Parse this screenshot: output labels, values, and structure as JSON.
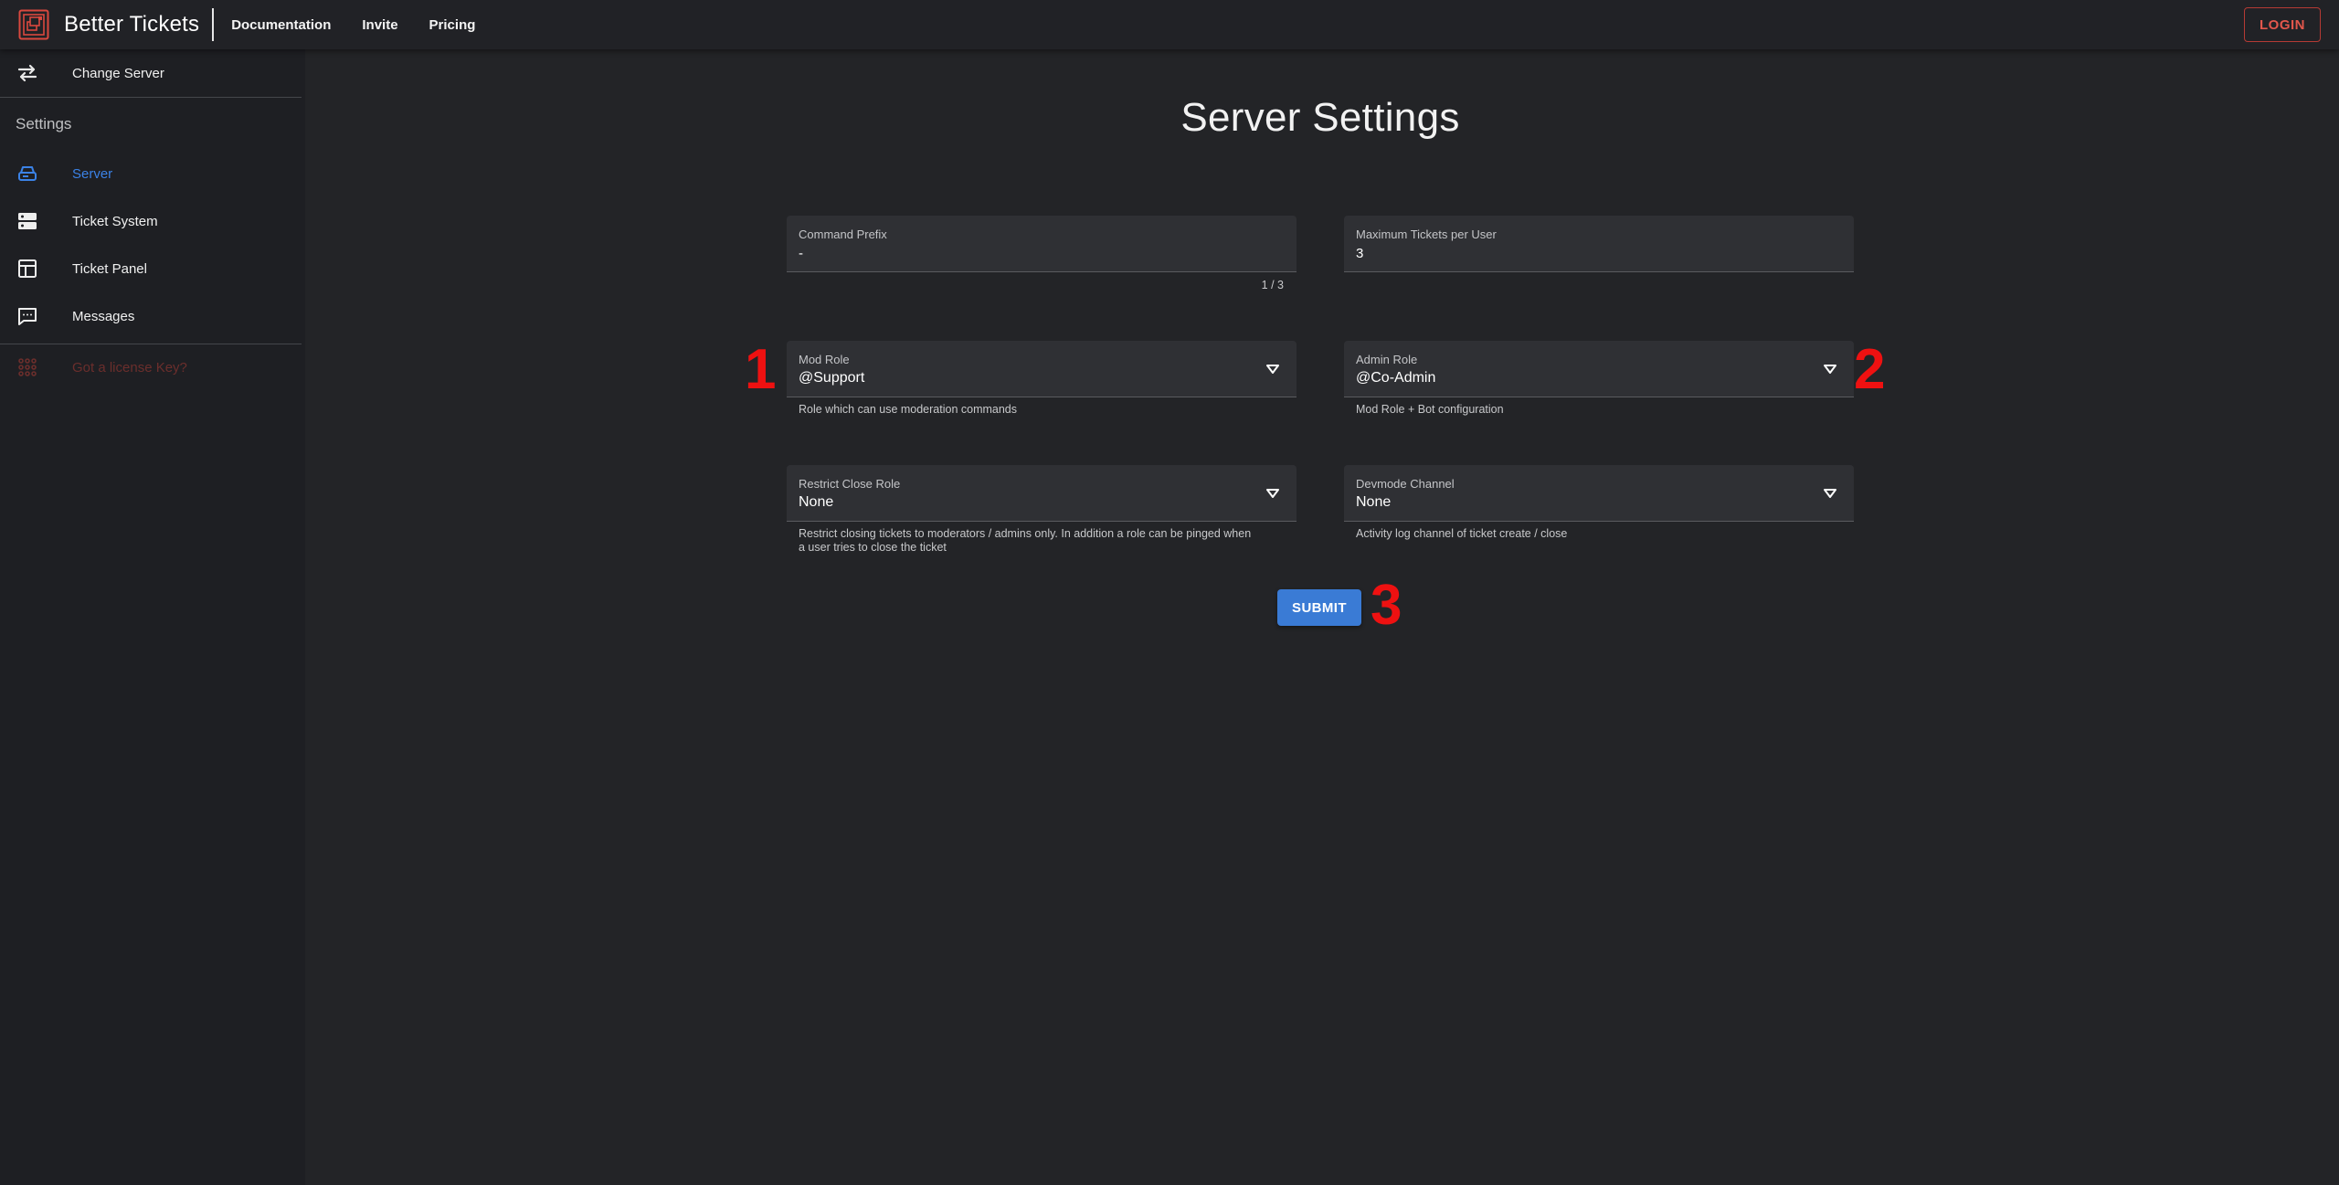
{
  "colors": {
    "background": "#232427",
    "sidebar": "#1e1f23",
    "accent": "#3a7bd5",
    "brand_red": "#e2574c",
    "marker_red": "#ee1111"
  },
  "header": {
    "brand": "Better Tickets",
    "nav": [
      "Documentation",
      "Invite",
      "Pricing"
    ],
    "login_label": "LOGIN",
    "logo_icon": "ticket-logo-icon"
  },
  "sidebar": {
    "change_server": {
      "label": "Change Server",
      "icon": "swap-arrows-icon"
    },
    "section_title": "Settings",
    "items": [
      {
        "label": "Server",
        "icon": "server-box-icon",
        "active": true
      },
      {
        "label": "Ticket System",
        "icon": "server-rack-icon"
      },
      {
        "label": "Ticket Panel",
        "icon": "panel-layout-icon"
      },
      {
        "label": "Messages",
        "icon": "message-dots-icon"
      }
    ],
    "license": {
      "label": "Got a license Key?",
      "icon": "grid-dots-icon"
    }
  },
  "main": {
    "title": "Server Settings",
    "command_prefix": {
      "label": "Command Prefix",
      "value": "-",
      "counter": "1 / 3"
    },
    "max_tickets": {
      "label": "Maximum Tickets per User",
      "value": "3"
    },
    "mod_role": {
      "label": "Mod Role",
      "value": "@Support",
      "helper": "Role which can use moderation commands"
    },
    "admin_role": {
      "label": "Admin Role",
      "value": "@Co-Admin",
      "helper": "Mod Role + Bot configuration"
    },
    "restrict_close_role": {
      "label": "Restrict Close Role",
      "value": "None",
      "helper_line1": "Restrict closing tickets to moderators / admins only. In addition a role can be pinged when",
      "helper_line2": "a user tries to close the ticket"
    },
    "devmode_channel": {
      "label": "Devmode Channel",
      "value": "None",
      "helper": "Activity log channel of ticket create / close"
    },
    "submit_label": "SUBMIT"
  },
  "markers": [
    "1",
    "2",
    "3"
  ]
}
